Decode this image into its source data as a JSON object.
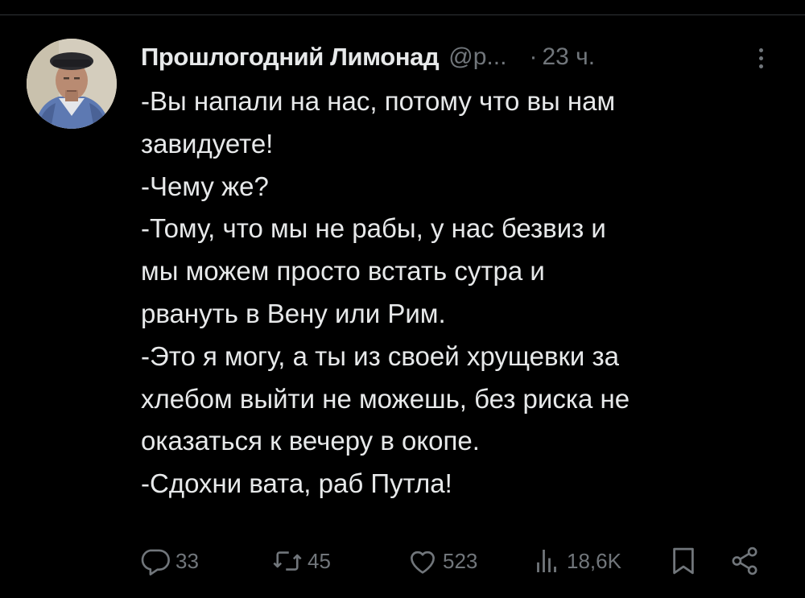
{
  "tweet": {
    "author_name": "Прошлогодний Лимонад",
    "author_handle": "@р...",
    "separator": "·",
    "timestamp": "23 ч.",
    "lines": [
      "-Вы напали на нас, потому что вы нам",
      "завидуете!",
      "-Чему же?",
      "-Тому, что мы не рабы, у нас безвиз и",
      "мы можем просто встать сутра и",
      "рвануть в Вену или Рим.",
      "-Это я могу, а ты из своей хрущевки за",
      "хлебом выйти не можешь, без риска не",
      "оказаться к вечеру в окопе.",
      "-Сдохни вата, раб Путла!"
    ]
  },
  "actions": {
    "replies": "33",
    "reposts": "45",
    "likes": "523",
    "views": "18,6K"
  },
  "icons": {
    "reply": "reply-icon",
    "repost": "repost-icon",
    "like": "heart-icon",
    "views": "bar-chart-icon",
    "bookmark": "bookmark-icon",
    "share": "share-icon",
    "more": "more-icon"
  },
  "colors": {
    "background": "#000000",
    "text": "#e7e9ea",
    "secondary": "#71767b"
  }
}
